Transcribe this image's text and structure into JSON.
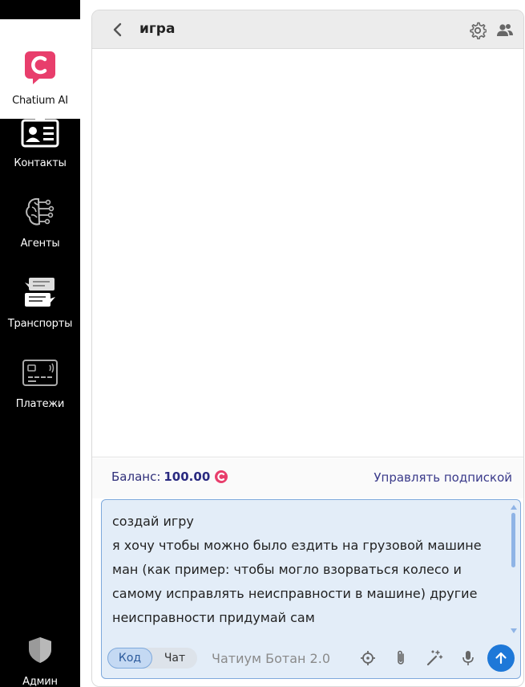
{
  "sidebar": {
    "items": [
      {
        "label": "Chatium AI",
        "icon": "chatium-logo-icon"
      },
      {
        "label": "Контакты",
        "icon": "contacts-card-icon"
      },
      {
        "label": "Агенты",
        "icon": "brain-circuit-icon"
      },
      {
        "label": "Транспорты",
        "icon": "message-stack-icon"
      },
      {
        "label": "Платежи",
        "icon": "payment-card-icon"
      }
    ],
    "admin": {
      "label": "Админ",
      "icon": "shield-icon"
    }
  },
  "header": {
    "title": "игра",
    "back_icon": "chevron-left-icon",
    "settings_icon": "gear-icon",
    "members_icon": "users-icon"
  },
  "balance": {
    "label": "Баланс:",
    "value": "100.00",
    "currency_icon": "chatium-coin-icon",
    "manage_link": "Управлять подпиской"
  },
  "composer": {
    "text": "создай игру\nя хочу чтобы можно было ездить на грузовой машине ман (как пример: чтобы могло взорваться колесо и самому исправлять неисправности в машине) другие неисправности придумай сам",
    "mode_options": [
      "Код",
      "Чат"
    ],
    "selected_mode": "Код",
    "model": "Чатиум Ботан 2.0"
  },
  "colors": {
    "brand": "#e83e6c",
    "accent": "#1e78d8",
    "sidebar_bg": "#000000",
    "input_bg": "#e3edf8"
  }
}
